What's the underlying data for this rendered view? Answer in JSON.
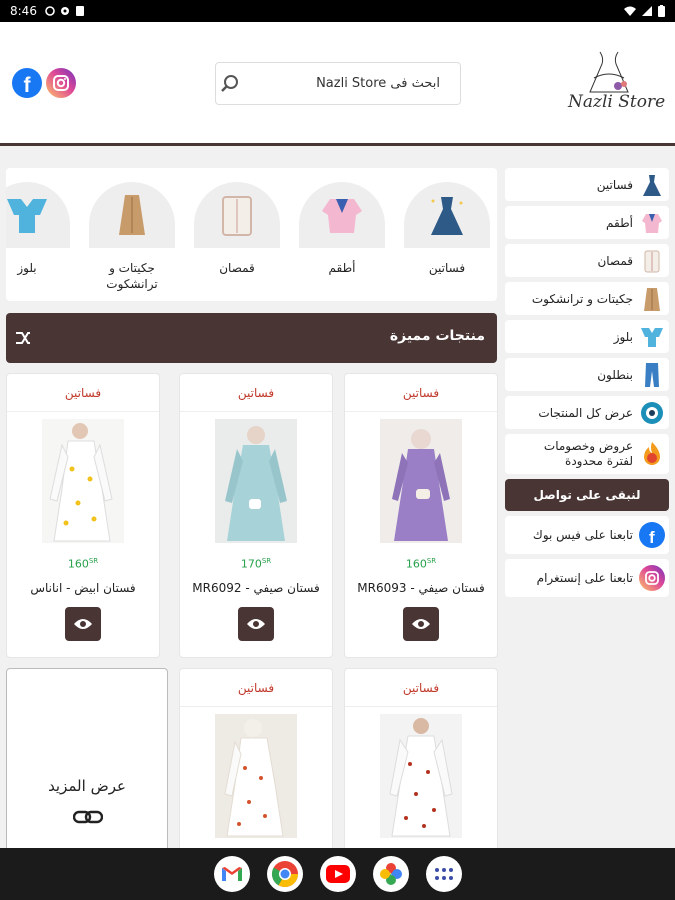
{
  "status_bar": {
    "time": "8:46"
  },
  "header": {
    "logo_text": "Nazli Store",
    "search": {
      "placeholder": "ابحث فى Nazli Store"
    }
  },
  "sidebar": {
    "items": [
      {
        "label": "فساتين",
        "icon": "dress-icon"
      },
      {
        "label": "أطقم",
        "icon": "suit-icon"
      },
      {
        "label": "قمصان",
        "icon": "shirt-icon"
      },
      {
        "label": "جكيتات و ترانشكوت",
        "icon": "coat-icon"
      },
      {
        "label": "بلوز",
        "icon": "blouse-icon"
      },
      {
        "label": "بنطلون",
        "icon": "pants-icon"
      },
      {
        "label": "عرض كل المنتجات",
        "icon": "eye-icon"
      },
      {
        "label": "عروض وخصومات لفترة محدودة",
        "icon": "discount-fire-icon"
      }
    ],
    "contact_heading": "لنبقى على تواصل",
    "contact": [
      {
        "label": "تابعنا على فيس بوك",
        "icon": "facebook-icon"
      },
      {
        "label": "تابعنا على إنستغرام",
        "icon": "instagram-icon"
      }
    ]
  },
  "categories": [
    {
      "label": "فساتين"
    },
    {
      "label": "أطقم"
    },
    {
      "label": "قمصان"
    },
    {
      "label": "جكيتات و ترانشكوت"
    },
    {
      "label": "بلوز"
    }
  ],
  "featured": {
    "title": "منتجات مميزة",
    "products": [
      {
        "category": "فساتين",
        "price": "160",
        "currency": "SR",
        "name": "فستان صيفي - MR6093",
        "color": "#9b7fc6"
      },
      {
        "category": "فساتين",
        "price": "170",
        "currency": "SR",
        "name": "فستان صيفي - MR6092",
        "color": "#a7d3d8"
      },
      {
        "category": "فساتين",
        "price": "160",
        "currency": "SR",
        "name": "فستان ابيض - اناناس",
        "color": "#f4f4f0"
      },
      {
        "category": "فساتين",
        "color": "#f6f6f6"
      },
      {
        "category": "فساتين",
        "color": "#f2efea"
      }
    ],
    "more_label": "عرض المزيد"
  }
}
